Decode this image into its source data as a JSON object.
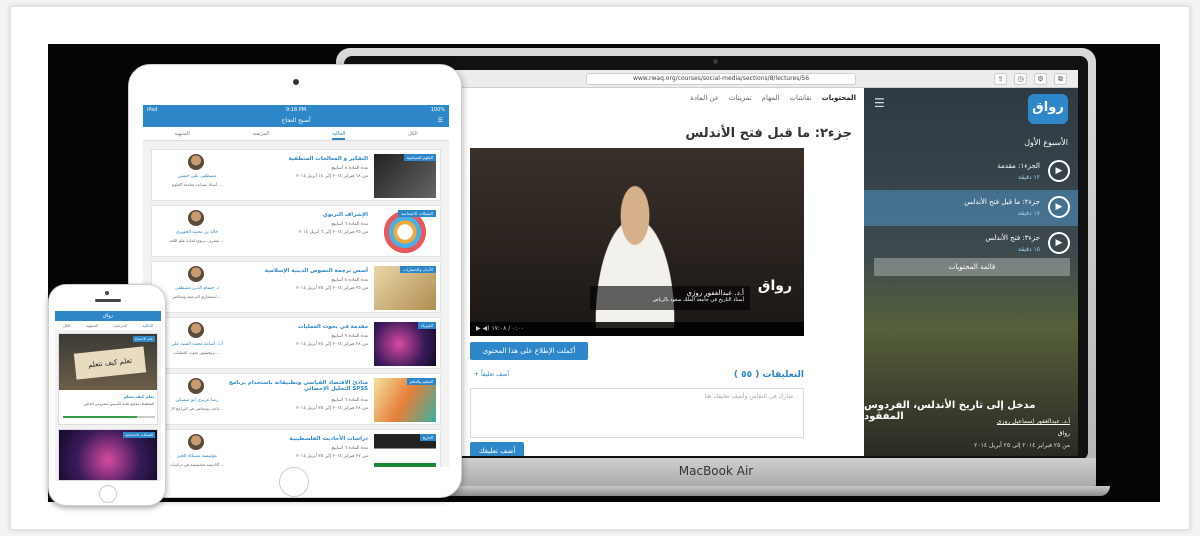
{
  "macbook": {
    "label": "MacBook Air",
    "url": "www.rwaq.org/courses/social-media/sections/8/lectures/56",
    "side_panel": {
      "logo": "رواق",
      "week_title": "الأسبوع الأول",
      "lessons": [
        {
          "title": "الجزء١: مقدمة",
          "sub": "١٢ دقيقة"
        },
        {
          "title": "جزء٢: ما قبل فتح الأندلس",
          "sub": "١٧ دقيقة"
        },
        {
          "title": "جزء٣: فتح الأندلس",
          "sub": "١٥ دقيقة"
        }
      ],
      "content_button": "قائمة المحتويات",
      "course_title": "مدخل إلى تاريخ الأندلس، الفردوس المفقود",
      "course_author": "أ.د. عبدالغفور إسماعيل روزي",
      "course_brand": "رواق",
      "course_date": "من ٢٥ فبراير ٢٠١٤ إلى ٢٥ أبريل ٢٠١٤"
    },
    "main": {
      "tabs": [
        "المحتويات",
        "نقاشات",
        "المهام",
        "تمرينات",
        "عن المادة"
      ],
      "lecture_title": "جزء٢: ما قبل فتح الأندلس",
      "video_caption_name": "أ.د. عبدالغفور روزي",
      "video_caption_role": "أستاذ التاريخ في جامعة الملك سعود بالرياض",
      "video_logo": "رواق",
      "video_time": "٠:٠٠ / ١٧:٠٨",
      "done_button": "أكملت الإطلاع على هذا المحتوى",
      "comments_title": "التعليقات ( ٥٥ )",
      "add_comment": "+ أضف تعليقاً",
      "comment_placeholder": "شارك في النقاش وأضف تعليقك هنا...",
      "submit_button": "أضف تعليقك"
    }
  },
  "ipad": {
    "status_left": "iPad",
    "status_time": "9:18 PM",
    "status_right": "100%",
    "header": "أصبح النجاح",
    "tabs": [
      "الكل",
      "الحالية",
      "المرتقبة",
      "المنتهية"
    ],
    "active_tab": "الحالية",
    "cards": [
      {
        "badge": "العلوم السياسية",
        "title": "التفكير و المعالجات المنطقية",
        "line1": "مدة المادة ٨ أسابيع",
        "line2": "من ١٨ فبراير ٢٠١٤ إلى ١٤ أبريل ٢٠١٤",
        "author": "مصطفى علي حسين",
        "role": "أستاذ مساعد بجامعة العلوم ..."
      },
      {
        "badge": "الشبكات الاجتماعية",
        "title": "الإشراف التربوي",
        "line1": "مدة المادة ٦ أسابيع",
        "line2": "من ٢٥ فبراير ٢٠١٤ إلى ٦ أبريل ٢٠١٤",
        "author": "خالد بن محمد الخويري",
        "role": "مشرف تربوي لمادة علم اللغة ..."
      },
      {
        "badge": "الأديان والحضارات",
        "title": "أسس ترجمة النصوص الدينية الإسلامية",
        "line1": "مدة المادة ٨ أسابيع",
        "line2": "من ٢٥ فبراير ٢٠١٤ إلى ٢٥ أبريل ٢٠١٤",
        "author": "د. حسام الدين مصطفى",
        "role": "استشاري الترجمة ومحاضر ..."
      },
      {
        "badge": "الفيزياء",
        "title": "مقدمة في بحوث العمليات",
        "line1": "مدة المادة ٩ أسابيع",
        "line2": "من ٢٨ فبراير ٢٠١٤ إلى ٢٨ أبريل ٢٠١٤",
        "author": "أ.د. أسامة محمد السيد علي",
        "role": "بروفيسور بحوث العمليات ..."
      },
      {
        "badge": "التعليم والتعلم",
        "title": "مبادئ الاقتصاد القياسي وتطبيقاته باستخدام برنامج التحليل الإحصائي SPSS",
        "line1": "مدة المادة ٦ أسابيع",
        "line2": "من ٢٨ فبراير ٢٠١٤ إلى ٢٥ أبريل ٢٠١٤",
        "author": "رضا عزيزي أبو سميكي",
        "role": "باحث ومحاضر في البرامج الإ..."
      },
      {
        "badge": "التاريخ",
        "title": "دراسات الأحاديث الفلسطينية",
        "line1": "مدة المادة ٦ أسابيع",
        "line2": "من ٢٧ فبراير ٢٠١٤ إلى ٢٥ أبريل ٢٠١٤",
        "author": "مؤسسة مشكاة الخير",
        "role": "أكاديمية متخصصة في دراسات ..."
      }
    ]
  },
  "iphone": {
    "header": "رواق",
    "tabs": [
      "الحالية",
      "المرتقبة",
      "المنتهية",
      "الكل"
    ],
    "active_tab": "الحالية",
    "card1": {
      "badge": "علم الاجتماع",
      "sign": "تعلم كيف تتعلم",
      "title": "تعلم كيف تتعلم",
      "line1": "التخطيط: مفاتيح هامة لتأسيس مشروعي الخاص",
      "progress": 0.8
    },
    "card2": {
      "badge": "الشبكات الاجتماعية"
    }
  },
  "colors": {
    "accent": "#2d87c8",
    "progress": "#39a04a"
  }
}
